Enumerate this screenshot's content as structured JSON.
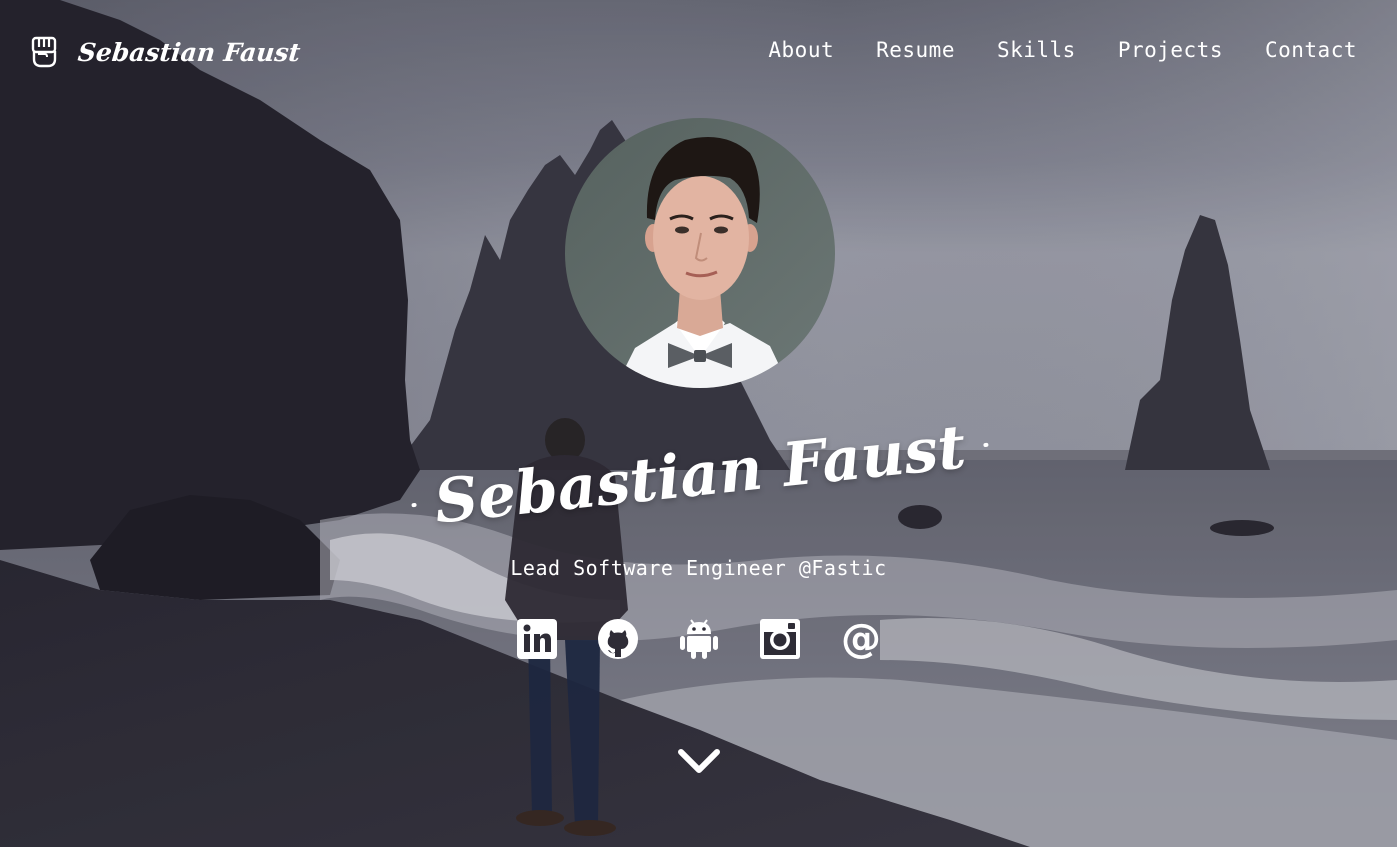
{
  "header": {
    "brand_name": "Sebastian Faust",
    "brand_icon": "fist-icon"
  },
  "nav": {
    "items": [
      {
        "label": "About"
      },
      {
        "label": "Resume"
      },
      {
        "label": "Skills"
      },
      {
        "label": "Projects"
      },
      {
        "label": "Contact"
      }
    ]
  },
  "hero": {
    "name": "Sebastian Faust",
    "tagline": "Lead Software Engineer @Fastic",
    "avatar_icon": "profile-photo",
    "social_icons": [
      "linkedin-icon",
      "github-icon",
      "android-icon",
      "instagram-icon",
      "email-at-icon"
    ],
    "email_glyph": "@",
    "scroll_icon": "chevron-down-icon"
  },
  "colors": {
    "text": "#ffffff",
    "sky": "#9fa2b0",
    "rock": "#25232e",
    "sand": "#2d2b36",
    "surf": "#c9cad2"
  }
}
